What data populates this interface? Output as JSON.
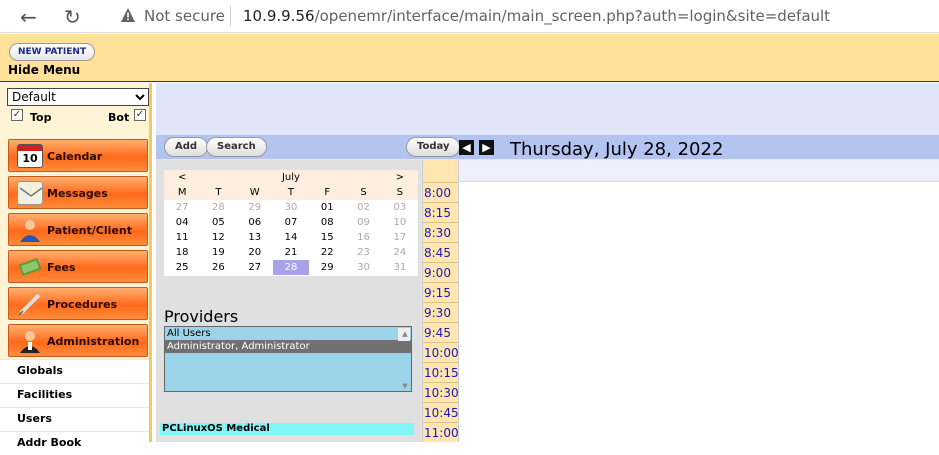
{
  "browser": {
    "not_secure": "Not secure",
    "url_host": "10.9.9.56",
    "url_path": "/openemr/interface/main/main_screen.php?auth=login&site=default"
  },
  "header": {
    "new_patient": "NEW PATIENT",
    "hide_menu": "Hide Menu"
  },
  "menu": {
    "selected_menu_set": "Default",
    "top_label": "Top",
    "bot_label": "Bot",
    "top_checked": true,
    "bot_checked": true,
    "buttons": [
      {
        "label": "Calendar",
        "icon": "calendar-icon"
      },
      {
        "label": "Messages",
        "icon": "messages-icon"
      },
      {
        "label": "Patient/Client",
        "icon": "patient-icon"
      },
      {
        "label": "Fees",
        "icon": "fees-icon"
      },
      {
        "label": "Procedures",
        "icon": "procedures-icon"
      },
      {
        "label": "Administration",
        "icon": "administration-icon"
      }
    ],
    "admin_items": [
      "Globals",
      "Facilities",
      "Users",
      "Addr Book"
    ]
  },
  "calendar": {
    "add": "Add",
    "search": "Search",
    "today": "Today",
    "current_date": "Thursday, July 28, 2022",
    "month": "July",
    "prev_month": "<",
    "next_month": ">",
    "weekdays": [
      "M",
      "T",
      "W",
      "T",
      "F",
      "S",
      "S"
    ],
    "weeks": [
      [
        "27",
        "28",
        "29",
        "30",
        "01",
        "02",
        "03"
      ],
      [
        "04",
        "05",
        "06",
        "07",
        "08",
        "09",
        "10"
      ],
      [
        "11",
        "12",
        "13",
        "14",
        "15",
        "16",
        "17"
      ],
      [
        "18",
        "19",
        "20",
        "21",
        "22",
        "23",
        "24"
      ],
      [
        "25",
        "26",
        "27",
        "28",
        "29",
        "30",
        "31"
      ]
    ],
    "selected_day": "28",
    "providers_title": "Providers",
    "providers": [
      "All Users",
      "Administrator, Administrator"
    ],
    "selected_provider": "Administrator, Administrator",
    "facility": "PCLinuxOS Medical",
    "times": [
      "8:00",
      "8:15",
      "8:30",
      "8:45",
      "9:00",
      "9:15",
      "9:30",
      "9:45",
      "10:00",
      "10:15",
      "10:30",
      "10:45",
      "11:00"
    ]
  },
  "colors": {
    "header_bg": "#ffe199",
    "menu_button": "#ff6a1a",
    "calendar_band": "#b4c4f0",
    "today_highlight": "#a9a2e8",
    "provider_list": "#9bd4e8",
    "facility_bar": "#7ff7f8"
  }
}
